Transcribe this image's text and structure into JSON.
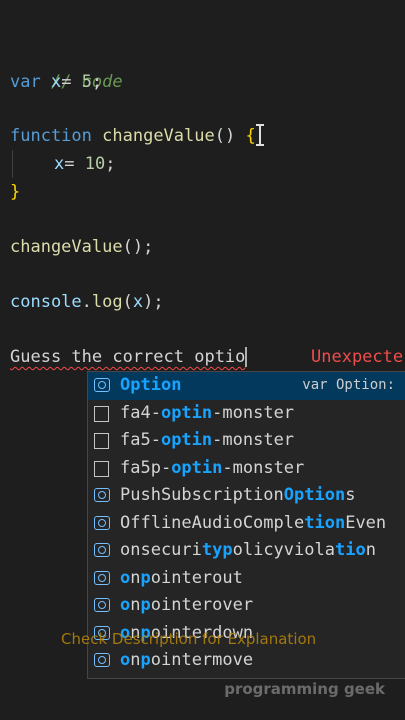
{
  "code": {
    "comment": "// code",
    "line_var": {
      "kw": "var",
      "name": " x",
      "op": "= ",
      "num": "5",
      "end": ";"
    },
    "line_fn": {
      "kw": "function",
      "name": "changeValue",
      "parens": "()",
      "brace": "{"
    },
    "line_assign": {
      "name": "x",
      "op": "= ",
      "num": "10",
      "end": ";"
    },
    "line_close": "}",
    "line_call": {
      "name": "changeValue",
      "rest": "();"
    },
    "line_log": {
      "obj": "console",
      "dot": ".",
      "method": "log",
      "open": "(",
      "arg": "x",
      "close": ");"
    },
    "line_guess": "Guess the correct optio",
    "error_text": "Unexpecte"
  },
  "suggestions": [
    {
      "kind": "variable",
      "icon": "variable-icon",
      "pre": "",
      "m1": "Optio",
      "mid": "",
      "m2": "n",
      "post": "",
      "detail": "var Option:"
    },
    {
      "kind": "text",
      "icon": "text-icon",
      "pre": "fa4-",
      "m1": "opti",
      "mid": "",
      "m2": "n",
      "post": "-monster",
      "detail": ""
    },
    {
      "kind": "text",
      "icon": "text-icon",
      "pre": "fa5-",
      "m1": "opti",
      "mid": "",
      "m2": "n",
      "post": "-monster",
      "detail": ""
    },
    {
      "kind": "text",
      "icon": "text-icon",
      "pre": "fa5p-",
      "m1": "opti",
      "mid": "",
      "m2": "n",
      "post": "-monster",
      "detail": ""
    },
    {
      "kind": "variable",
      "icon": "variable-icon",
      "pre": "PushSubscription",
      "m1": "Optio",
      "mid": "",
      "m2": "n",
      "post": "s",
      "detail": ""
    },
    {
      "kind": "variable",
      "icon": "variable-icon",
      "pre": "OfflineAudioComple",
      "m1": "tio",
      "mid": "",
      "m2": "n",
      "post": "Even",
      "detail": ""
    },
    {
      "kind": "variable",
      "icon": "variable-icon",
      "pre": "onsecuri",
      "m1": "typ",
      "mid": "olicyviola",
      "m2": "tio",
      "post": "n",
      "detail": ""
    },
    {
      "kind": "variable",
      "icon": "variable-icon",
      "pre": "",
      "m1": "o",
      "mid": "n",
      "m2": "p",
      "post": "ointerout",
      "detail": ""
    },
    {
      "kind": "variable",
      "icon": "variable-icon",
      "pre": "",
      "m1": "o",
      "mid": "n",
      "m2": "p",
      "post": "ointerover",
      "detail": ""
    },
    {
      "kind": "variable",
      "icon": "variable-icon",
      "pre": "",
      "m1": "o",
      "mid": "n",
      "m2": "p",
      "post": "ointerdown",
      "detail": ""
    },
    {
      "kind": "variable",
      "icon": "variable-icon",
      "pre": "",
      "m1": "o",
      "mid": "n",
      "m2": "p",
      "post": "ointermove",
      "detail": ""
    }
  ],
  "watermark": "Check Description for Explanation",
  "brand": "programming geek"
}
